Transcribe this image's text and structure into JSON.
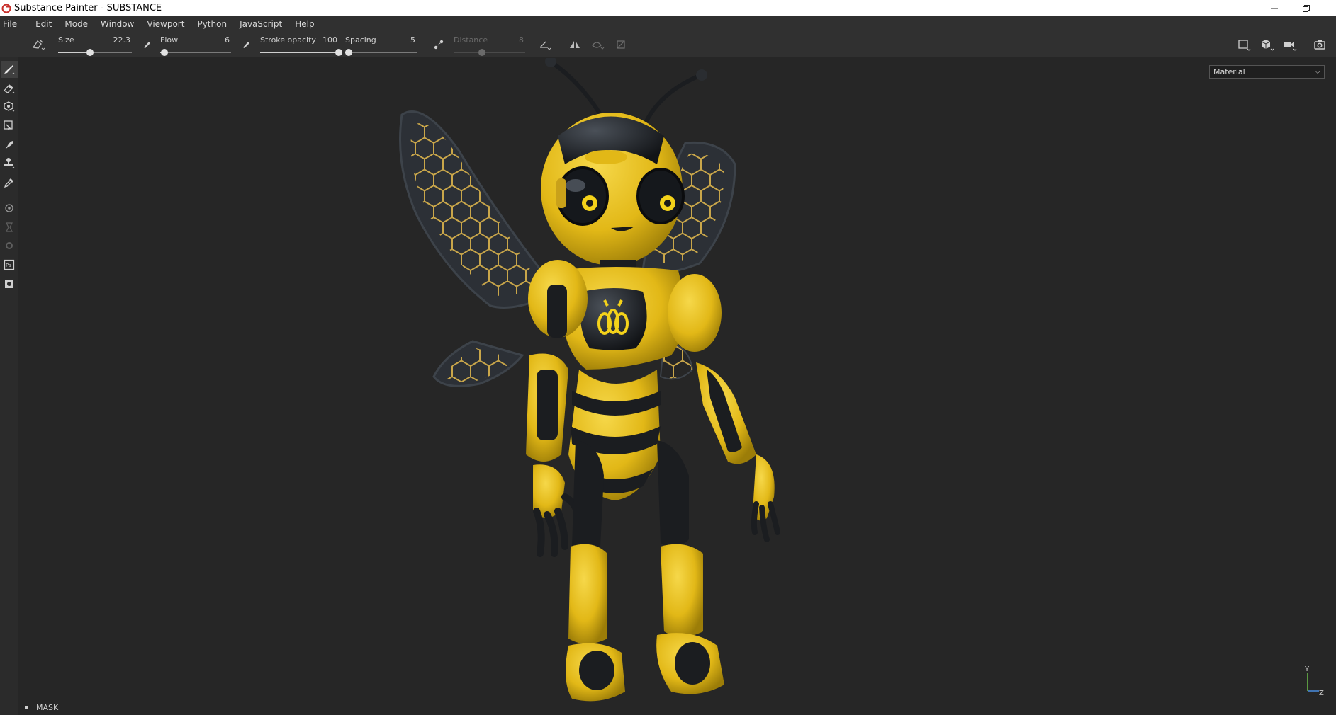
{
  "window": {
    "title": "Substance Painter - SUBSTANCE"
  },
  "menu": {
    "items": [
      "File",
      "Edit",
      "Mode",
      "Window",
      "Viewport",
      "Python",
      "JavaScript",
      "Help"
    ]
  },
  "brush_params": {
    "size": {
      "label": "Size",
      "value": "22.3",
      "fraction": 0.43
    },
    "flow": {
      "label": "Flow",
      "value": "6",
      "fraction": 0.06
    },
    "stroke_opacity": {
      "label": "Stroke opacity",
      "value": "100",
      "fraction": 1.0
    },
    "spacing": {
      "label": "Spacing",
      "value": "5",
      "fraction": 0.05
    },
    "distance": {
      "label": "Distance",
      "value": "8",
      "fraction": 0.4
    }
  },
  "viewport": {
    "display_mode": "Material",
    "axis_labels": {
      "y": "Y",
      "z": "Z"
    }
  },
  "bottom": {
    "mask_label": "MASK"
  },
  "left_tools": [
    "paint-brush-icon",
    "eraser-icon",
    "projection-icon",
    "polygon-fill-icon",
    "smudge-icon",
    "clone-stamp-icon",
    "color-picker-icon",
    "bake-icon",
    "iray-icon",
    "export-icon",
    "photoshop-export-icon",
    "texture-export-icon"
  ],
  "colors": {
    "app_bg": "#262626",
    "panel_bg": "#303030",
    "bee_yellow": "#e8c217",
    "bee_dark": "#1c1f22"
  }
}
